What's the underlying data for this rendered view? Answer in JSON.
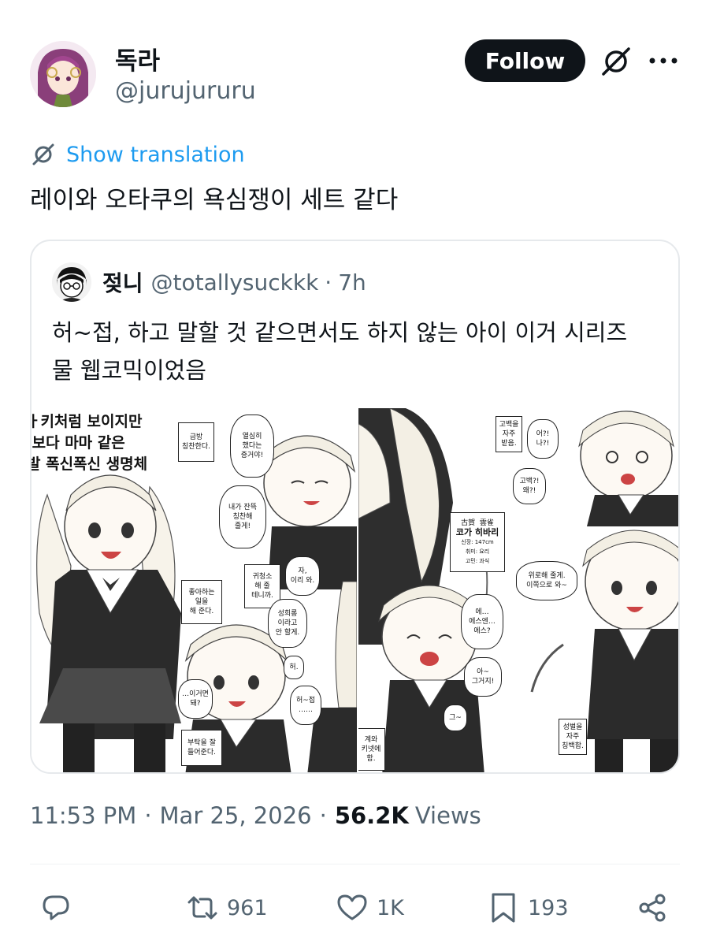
{
  "author": {
    "display_name": "독라",
    "handle": "@jurujururu"
  },
  "header": {
    "follow_label": "Follow"
  },
  "translation": {
    "label": "Show translation"
  },
  "tweet": {
    "text": "레이와 오타쿠의 욕심쟁이 세트 같다"
  },
  "quote": {
    "display_name": "젖니",
    "handle": "@totallysuckkk",
    "separator": "·",
    "time": "7h",
    "text_line1": "허~접, 하고 말할 것 같으면서도 하지 않는 아이 이거 시리즈",
    "text_line2": "물 웹코믹이었음"
  },
  "comic": {
    "left": {
      "title": "ㅏ키처럼 보이지만\n·보다 마마 같은\n발 폭신폭신 생명체",
      "bubbles": [
        "금방\n칭찬한다.",
        "열심히\n했다는\n증거야!",
        "내가 잔뜩\n칭찬해\n줄게!",
        "좋아하는\n일을\n해 준다.",
        "귀청소\n해 줄\n테니까.",
        "자,\n이리 와.",
        "성희롱\n이라고\n안 할게.",
        "허.",
        "…이거면\n돼?",
        "허~접\n……",
        "부탁을 잘\n들어준다."
      ]
    },
    "right": {
      "bubbles": [
        "고백을\n자주\n받음.",
        "어?!\n나?!",
        "고백?!\n왜?!",
        "위로해 줄게.\n이쪽으로 와~",
        "에…\n에스엔…\n에스?",
        "아~\n그거지!",
        "그~",
        "계와\n키넷에\n함.",
        "성벌을\n자주\n칭백함."
      ],
      "profile": {
        "header": "古賀  雲雀",
        "name": "코가 히바리",
        "height": "신장: 147cm",
        "hobby": "취미: 요리",
        "worry": "고민: 과식"
      }
    }
  },
  "meta": {
    "time": "11:53 PM",
    "separator": "·",
    "date": "Mar 25, 2026",
    "views_count": "56.2K",
    "views_label": "Views"
  },
  "actions": {
    "reposts": "961",
    "likes": "1K",
    "bookmarks": "193"
  },
  "colors": {
    "accent": "#1d9bf0",
    "text_primary": "#0f1419",
    "text_secondary": "#536471",
    "follow_bg": "#0f1419"
  }
}
